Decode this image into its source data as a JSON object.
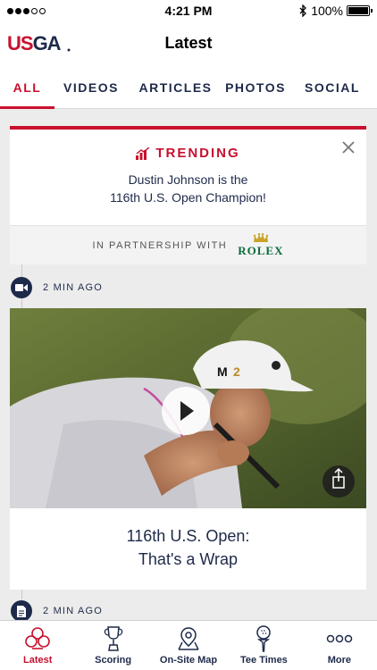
{
  "status_bar": {
    "time": "4:21 PM",
    "battery": "100%",
    "battery_level": 1.0,
    "signal_bars_filled": 3,
    "signal_bars_total": 5
  },
  "header": {
    "logo_text": "USGA",
    "title": "Latest"
  },
  "tabs": [
    {
      "label": "ALL",
      "active": true
    },
    {
      "label": "VIDEOS",
      "active": false
    },
    {
      "label": "ARTICLES",
      "active": false
    },
    {
      "label": "PHOTOS",
      "active": false
    },
    {
      "label": "SOCIAL",
      "active": false
    }
  ],
  "trending": {
    "heading": "TRENDING",
    "line1": "Dustin Johnson is the",
    "line2": "116th U.S. Open Champion!",
    "partner_label": "IN PARTNERSHIP WITH",
    "partner_name": "ROLEX"
  },
  "feed": {
    "items": [
      {
        "type_icon": "video-camera-icon",
        "time_ago": "2 MIN AGO",
        "title_line1": "116th U.S. Open:",
        "title_line2": "That's a Wrap"
      },
      {
        "type_icon": "document-icon",
        "time_ago": "2 MIN AGO"
      }
    ]
  },
  "bottom_nav": [
    {
      "label": "Latest",
      "icon": "usga-crest-icon",
      "active": true
    },
    {
      "label": "Scoring",
      "icon": "trophy-icon",
      "active": false
    },
    {
      "label": "On-Site Map",
      "icon": "map-pin-icon",
      "active": false
    },
    {
      "label": "Tee Times",
      "icon": "golf-tee-icon",
      "active": false
    },
    {
      "label": "More",
      "icon": "more-dots-icon",
      "active": false
    }
  ],
  "colors": {
    "accent": "#c8102e",
    "navy": "#1e2a4a",
    "rolex_green": "#0a6b3c"
  }
}
